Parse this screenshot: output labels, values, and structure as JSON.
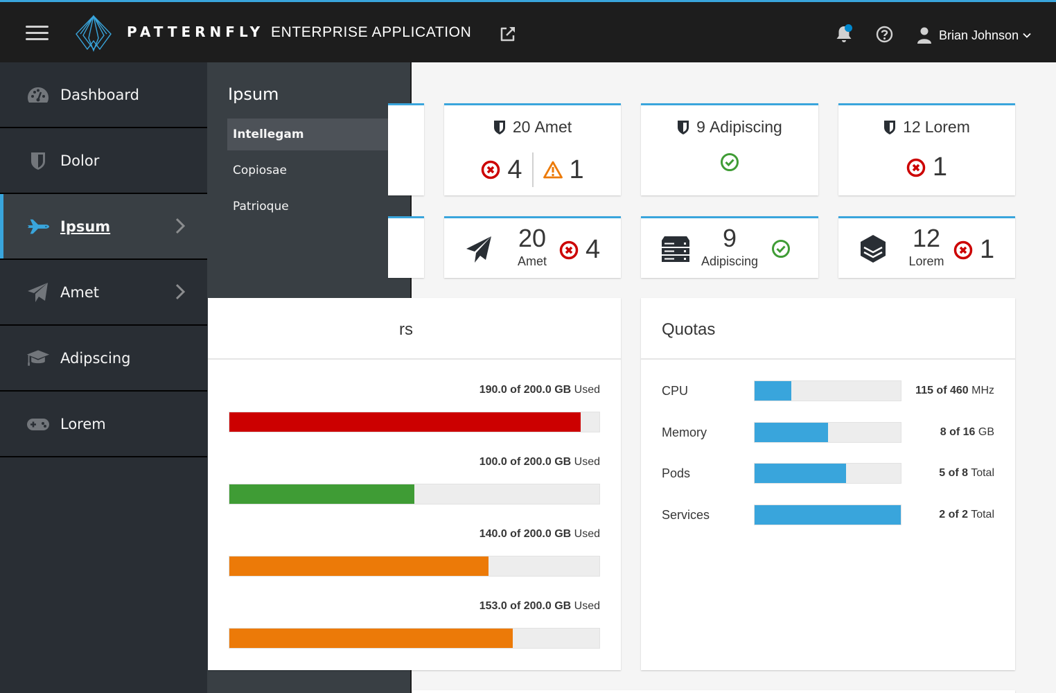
{
  "masthead": {
    "brand_name": "PATTERNFLY",
    "brand_subtitle": "ENTERPRISE APPLICATION",
    "menu_icon": "hamburger-icon",
    "external_link_icon": "external-link-icon",
    "notification_icon": "bell-icon",
    "notification_unread": true,
    "help_icon": "question-circle-icon",
    "user": {
      "name": "Brian Johnson",
      "icon": "user-icon"
    }
  },
  "colors": {
    "accent": "#39a5dc",
    "danger": "#cc0000",
    "warning": "#ec7a08",
    "success": "#3f9c35",
    "masthead_bg": "#1d1d1d",
    "nav_bg": "#292e34",
    "secondary_nav_bg": "#393f44"
  },
  "nav": {
    "items": [
      {
        "label": "Dashboard",
        "icon": "dashboard-icon",
        "active": false,
        "has_submenu": false
      },
      {
        "label": "Dolor",
        "icon": "shield-icon",
        "active": false,
        "has_submenu": false
      },
      {
        "label": "Ipsum",
        "icon": "space-shuttle-icon",
        "active": true,
        "has_submenu": true
      },
      {
        "label": "Amet",
        "icon": "paper-plane-icon",
        "active": false,
        "has_submenu": true
      },
      {
        "label": "Adipscing",
        "icon": "graduation-cap-icon",
        "active": false,
        "has_submenu": false
      },
      {
        "label": "Lorem",
        "icon": "gamepad-icon",
        "active": false,
        "has_submenu": false
      }
    ]
  },
  "secondary_nav": {
    "title": "Ipsum",
    "items": [
      {
        "label": "Intellegam",
        "active": true
      },
      {
        "label": "Copiosae",
        "active": false
      },
      {
        "label": "Patrioque",
        "active": false
      }
    ]
  },
  "aggregate_cards": [
    {
      "count": "20",
      "label": "Amet",
      "icon": "shield-icon",
      "errors": "4",
      "warnings": "1"
    },
    {
      "count": "9",
      "label": "Adipiscing",
      "icon": "shield-icon",
      "status": "ok"
    },
    {
      "count": "12",
      "label": "Lorem",
      "icon": "shield-icon",
      "errors": "1"
    }
  ],
  "mini_cards": [
    {
      "count": "20",
      "label": "Amet",
      "icon": "paper-plane-icon",
      "errors": "4"
    },
    {
      "count": "9",
      "label": "Adipiscing",
      "icon": "server-icon",
      "status": "ok"
    },
    {
      "count": "12",
      "label": "Lorem",
      "icon": "layers-icon",
      "errors": "1"
    }
  ],
  "utilization": {
    "title_visible_fragment": "rs",
    "bars": [
      {
        "used": "190.0",
        "total": "200.0",
        "unit": "GB",
        "suffix": "Used",
        "percent": 95,
        "color": "#cc0000"
      },
      {
        "used": "100.0",
        "total": "200.0",
        "unit": "GB",
        "suffix": "Used",
        "percent": 50,
        "color": "#3f9c35"
      },
      {
        "used": "140.0",
        "total": "200.0",
        "unit": "GB",
        "suffix": "Used",
        "percent": 70,
        "color": "#ec7a08"
      },
      {
        "used": "153.0",
        "total": "200.0",
        "unit": "GB",
        "suffix": "Used",
        "percent": 76.5,
        "color": "#ec7a08"
      }
    ]
  },
  "quotas": {
    "title": "Quotas",
    "rows": [
      {
        "label": "CPU",
        "used": "115",
        "total": "460",
        "unit": "MHz",
        "percent": 25
      },
      {
        "label": "Memory",
        "used": "8",
        "total": "16",
        "unit": "GB",
        "percent": 50
      },
      {
        "label": "Pods",
        "used": "5",
        "total": "8",
        "unit": "Total",
        "percent": 62.5
      },
      {
        "label": "Services",
        "used": "2",
        "total": "2",
        "unit": "Total",
        "percent": 100
      }
    ]
  }
}
